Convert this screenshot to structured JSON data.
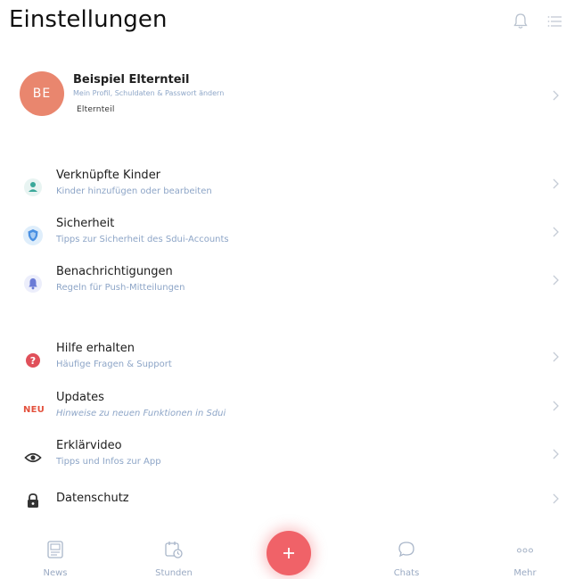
{
  "header": {
    "title": "Einstellungen",
    "icons": [
      "bell-icon",
      "list-icon"
    ]
  },
  "profile": {
    "initials": "BE",
    "name": "Beispiel Elternteil",
    "subtitle": "Mein Profil, Schuldaten & Passwort ändern",
    "role": "Elternteil",
    "avatar_color": "#e9866e"
  },
  "sections": {
    "linked_children": {
      "title": "Verknüpfte Kinder",
      "subtitle": "Kinder hinzufügen oder bearbeiten",
      "icon": "person-icon",
      "icon_color": "#3aa89a"
    },
    "security": {
      "title": "Sicherheit",
      "subtitle": "Tipps zur Sicherheit des Sdui-Accounts",
      "icon": "shield-icon",
      "icon_color": "#4a90e2"
    },
    "notifications": {
      "title": "Benachrichtigungen",
      "subtitle": "Regeln für Push-Mitteilungen",
      "icon": "bell-icon",
      "icon_color": "#6b7bd6"
    },
    "help": {
      "title": "Hilfe erhalten",
      "subtitle": "Häufige Fragen & Support",
      "icon": "question-icon",
      "icon_color": "#e0505a"
    },
    "updates": {
      "badge": "NEU",
      "title": "Updates",
      "subtitle": "Hinweise zu neuen Funktionen in Sdui",
      "badge_color": "#e3513d"
    },
    "video": {
      "title": "Erklärvideo",
      "subtitle": "Tipps und Infos zur App",
      "icon": "eye-icon"
    },
    "privacy": {
      "title": "Datenschutz",
      "icon": "lock-icon"
    }
  },
  "bottom_nav": {
    "news": "News",
    "stunden": "Stunden",
    "chats": "Chats",
    "mehr": "Mehr",
    "fab_icon": "plus-icon",
    "fab_color": "#f06268"
  }
}
